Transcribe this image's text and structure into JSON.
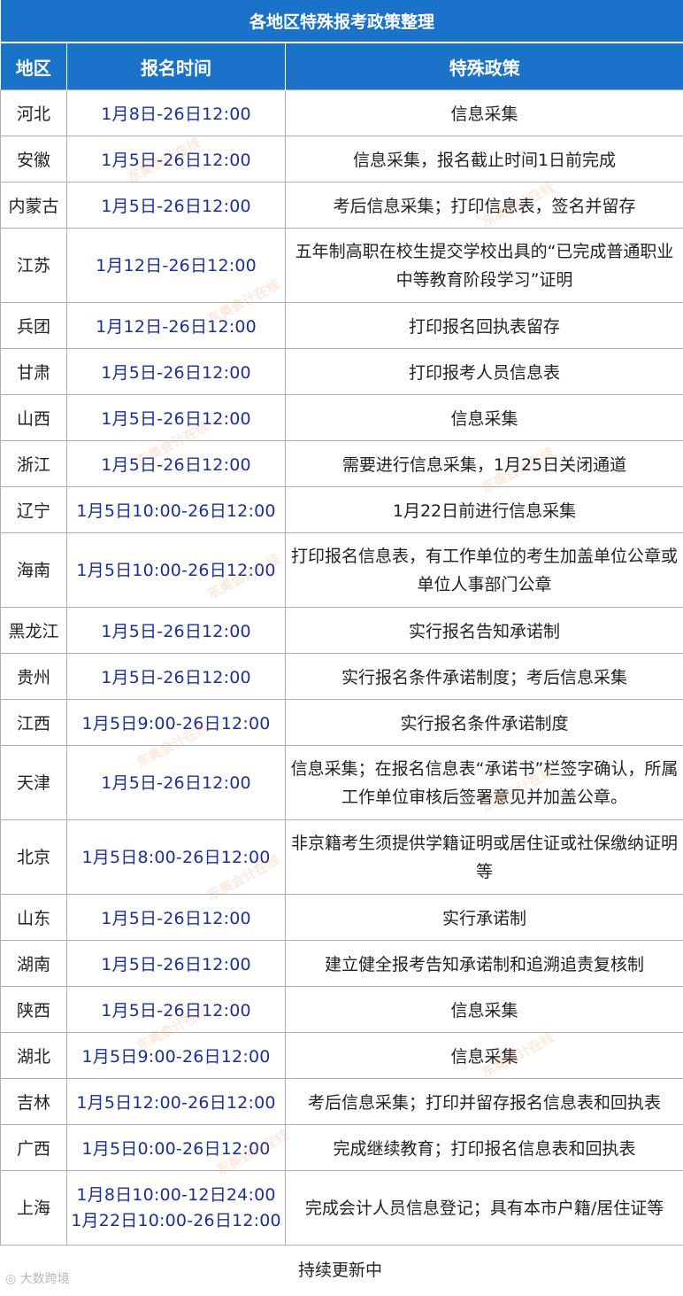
{
  "title": "各地区特殊报考政策整理",
  "headers": [
    "地区",
    "报名时间",
    "特殊政策"
  ],
  "rows": [
    {
      "region": "河北",
      "time": "1月8日-26日12:00",
      "policy": "信息采集"
    },
    {
      "region": "安徽",
      "time": "1月5日-26日12:00",
      "policy": "信息采集，报名截止时间1日前完成"
    },
    {
      "region": "内蒙古",
      "time": "1月5日-26日12:00",
      "policy": "考后信息采集；打印信息表，签名并留存"
    },
    {
      "region": "江苏",
      "time": "1月12日-26日12:00",
      "policy": "五年制高职在校生提交学校出具的“已完成普通职业中等教育阶段学习”证明"
    },
    {
      "region": "兵团",
      "time": "1月12日-26日12:00",
      "policy": "打印报名回执表留存"
    },
    {
      "region": "甘肃",
      "time": "1月5日-26日12:00",
      "policy": "打印报考人员信息表"
    },
    {
      "region": "山西",
      "time": "1月5日-26日12:00",
      "policy": "信息采集"
    },
    {
      "region": "浙江",
      "time": "1月5日-26日12:00",
      "policy": "需要进行信息采集，1月25日关闭通道"
    },
    {
      "region": "辽宁",
      "time": "1月5日10:00-26日12:00",
      "policy": "1月22日前进行信息采集"
    },
    {
      "region": "海南",
      "time": "1月5日10:00-26日12:00",
      "policy": "打印报名信息表，有工作单位的考生加盖单位公章或单位人事部门公章"
    },
    {
      "region": "黑龙江",
      "time": "1月5日-26日12:00",
      "policy": "实行报名告知承诺制"
    },
    {
      "region": "贵州",
      "time": "1月5日-26日12:00",
      "policy": "实行报名条件承诺制度；考后信息采集"
    },
    {
      "region": "江西",
      "time": "1月5日9:00-26日12:00",
      "policy": "实行报名条件承诺制度"
    },
    {
      "region": "天津",
      "time": "1月5日-26日12:00",
      "policy": "信息采集；在报名信息表“承诺书”栏签字确认，所属工作单位审核后签署意见并加盖公章。"
    },
    {
      "region": "北京",
      "time": "1月5日8:00-26日12:00",
      "policy": "非京籍考生须提供学籍证明或居住证或社保缴纳证明等"
    },
    {
      "region": "山东",
      "time": "1月5日-26日12:00",
      "policy": "实行承诺制"
    },
    {
      "region": "湖南",
      "time": "1月5日-26日12:00",
      "policy": "建立健全报考告知承诺制和追溯追责复核制"
    },
    {
      "region": "陕西",
      "time": "1月5日-26日12:00",
      "policy": "信息采集"
    },
    {
      "region": "湖北",
      "time": "1月5日9:00-26日12:00",
      "policy": "信息采集"
    },
    {
      "region": "吉林",
      "time": "1月5日12:00-26日12:00",
      "policy": "考后信息采集；打印并留存报名信息表和回执表"
    },
    {
      "region": "广西",
      "time": "1月5日0:00-26日12:00",
      "policy": "完成继续教育；打印报名信息表和回执表"
    },
    {
      "region": "上海",
      "time": "1月8日10:00-12日24:00",
      "time_line2": "1月22日10:00-26日12:00",
      "policy": "完成会计人员信息登记；具有本市户籍/居住证等"
    }
  ],
  "footer": "持续更新中",
  "watermark": "东奥会计在线",
  "brand": "大数跨境"
}
